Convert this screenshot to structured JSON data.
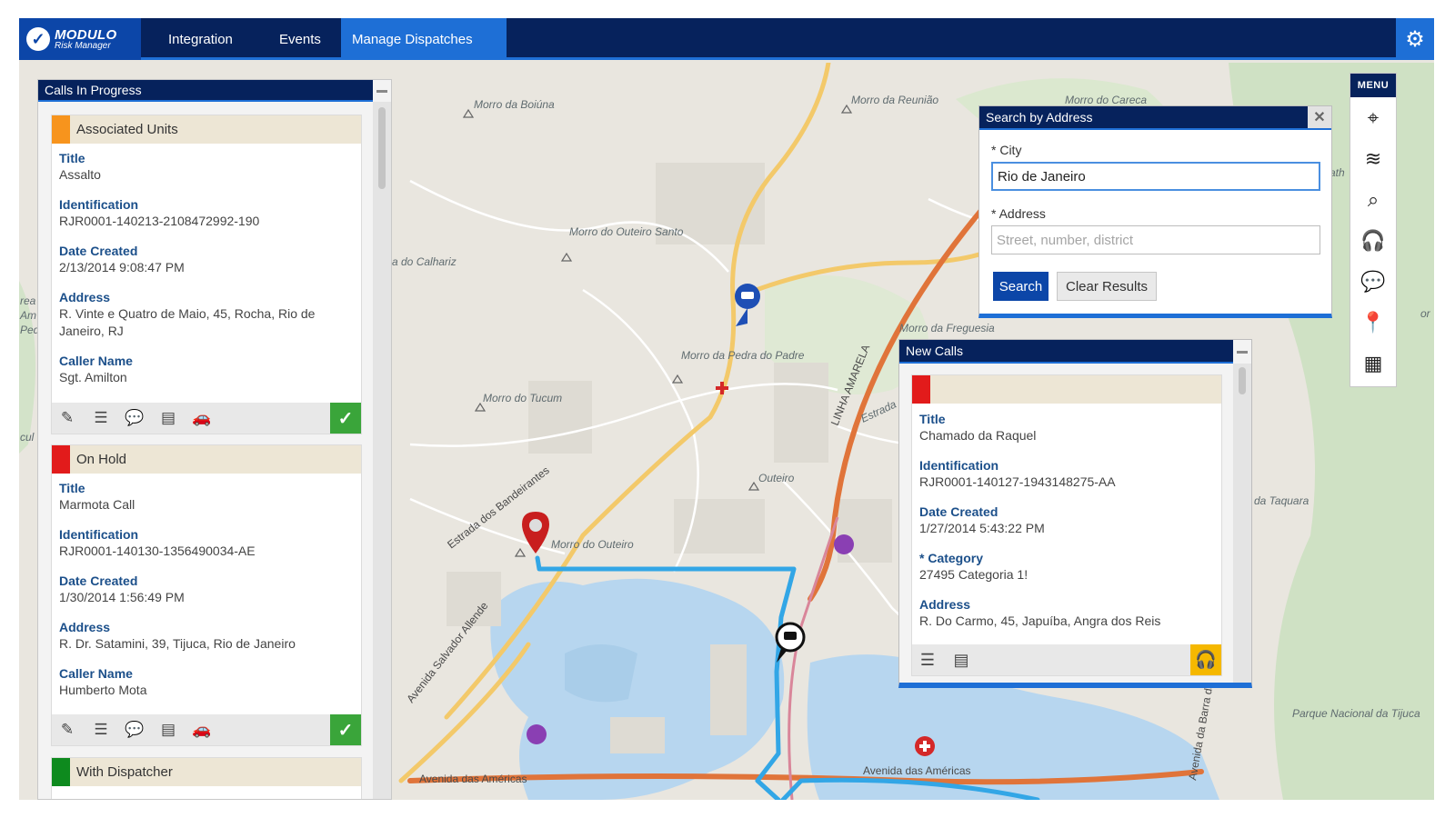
{
  "header": {
    "logo_brand": "MODULO",
    "logo_sub": "Risk Manager",
    "nav": [
      "Integration",
      "Events",
      "Manage Dispatches"
    ],
    "active_nav": "Manage Dispatches"
  },
  "calls_in_progress": {
    "title": "Calls In Progress",
    "cards": [
      {
        "status": "Associated Units",
        "status_color": "#f7941d",
        "fields": [
          {
            "label": "Title",
            "value": "Assalto"
          },
          {
            "label": "Identification",
            "value": "RJR0001-140213-2108472992-190"
          },
          {
            "label": "Date Created",
            "value": "2/13/2014 9:08:47 PM"
          },
          {
            "label": "Address",
            "value": "R. Vinte e Quatro de Maio, 45, Rocha, Rio de Janeiro, RJ"
          },
          {
            "label": "Caller Name",
            "value": "Sgt. Amilton"
          }
        ]
      },
      {
        "status": "On Hold",
        "status_color": "#e21b1b",
        "fields": [
          {
            "label": "Title",
            "value": "Marmota Call"
          },
          {
            "label": "Identification",
            "value": "RJR0001-140130-1356490034-AE"
          },
          {
            "label": "Date Created",
            "value": "1/30/2014 1:56:49 PM"
          },
          {
            "label": "Address",
            "value": "R. Dr. Satamini, 39, Tijuca, Rio de Janeiro"
          },
          {
            "label": "Caller Name",
            "value": "Humberto Mota"
          }
        ]
      },
      {
        "status": "With Dispatcher",
        "status_color": "#0e8a1e"
      }
    ]
  },
  "search": {
    "title": "Search by Address",
    "city_label": "* City",
    "city_value": "Rio de Janeiro",
    "address_label": "* Address",
    "address_placeholder": "Street, number, district",
    "search_label": "Search",
    "clear_label": "Clear Results"
  },
  "new_calls": {
    "title": "New Calls",
    "status_color": "#e21b1b",
    "fields": [
      {
        "label": "Title",
        "value": "Chamado da Raquel"
      },
      {
        "label": "Identification",
        "value": "RJR0001-140127-1943148275-AA"
      },
      {
        "label": "Date Created",
        "value": "1/27/2014 5:43:22 PM"
      },
      {
        "label": "* Category",
        "value": "27495 Categoria 1!"
      },
      {
        "label": "Address",
        "value": "R. Do Carmo, 45, Japuíba, Angra dos Reis"
      }
    ]
  },
  "right_menu": {
    "title": "MENU",
    "items": [
      "map-pin-icon",
      "layers-icon",
      "map-search-icon",
      "headset-icon",
      "chat-icon",
      "location-device-icon",
      "grid-icon"
    ]
  },
  "map_labels": {
    "places": [
      "Morro da Boiúna",
      "Morro da Reunião",
      "Morro do Careca",
      "Morro do Outeiro Santo",
      "a do Calhariz",
      "Morro da Pedra do Padre",
      "Morro do Tucum",
      "Morro da Freguesia",
      "Outeiro",
      "Morro do Outeiro",
      "da Taquara",
      "Parque Nacional da Tijuca",
      "Estrada"
    ],
    "roads": [
      "Estrada dos Bandeirantes",
      "Avenida Salvador Allende",
      "Avenida das Américas",
      "LINHA AMARELA",
      "Avenida das Américas",
      "Avenida da Barra da Tijuca"
    ],
    "edge": [
      "rea",
      "Am",
      "Ped",
      "cul",
      "ath",
      "or"
    ]
  }
}
